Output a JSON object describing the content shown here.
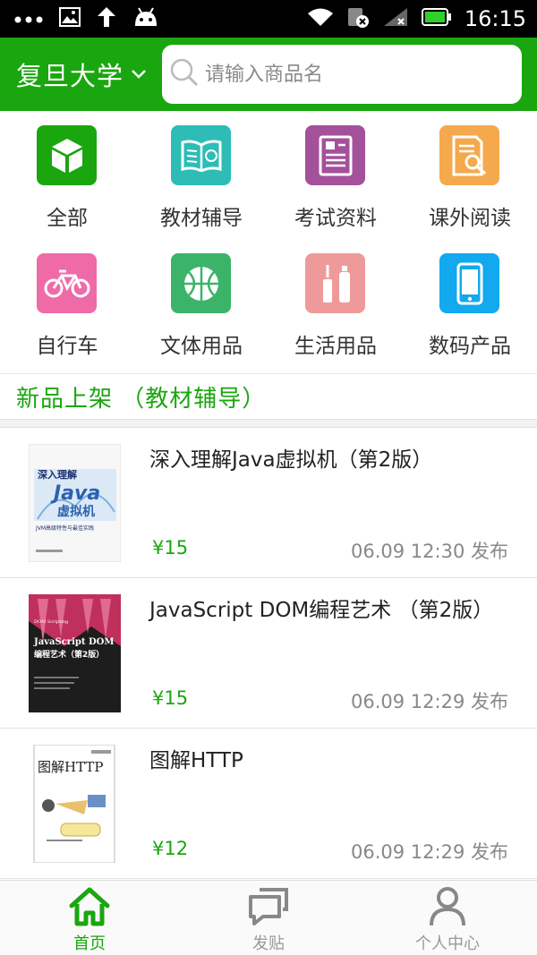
{
  "status_bar": {
    "time": "16:15",
    "left_icons": [
      "more-dots-icon",
      "image-icon",
      "upload-arrow-icon",
      "android-icon"
    ],
    "right_icons": [
      "wifi-icon",
      "no-sim-icon",
      "signal-icon",
      "battery-icon"
    ]
  },
  "header": {
    "campus": "复旦大学",
    "search_placeholder": "请输入商品名",
    "accent_color": "#1aa60f"
  },
  "categories": [
    {
      "label": "全部",
      "icon": "cube-icon",
      "color": "#1aa60f"
    },
    {
      "label": "教材辅导",
      "icon": "book-icon",
      "color": "#2dbcb6"
    },
    {
      "label": "考试资料",
      "icon": "exam-doc-icon",
      "color": "#a4519b"
    },
    {
      "label": "课外阅读",
      "icon": "reading-search-icon",
      "color": "#f5a94d"
    },
    {
      "label": "自行车",
      "icon": "bicycle-icon",
      "color": "#ef6ba8"
    },
    {
      "label": "文体用品",
      "icon": "basketball-icon",
      "color": "#3bb469"
    },
    {
      "label": "生活用品",
      "icon": "toiletries-icon",
      "color": "#ef9a9a"
    },
    {
      "label": "数码产品",
      "icon": "phone-icon",
      "color": "#12a9ee"
    }
  ],
  "section": {
    "title": "新品上架 （教材辅导）"
  },
  "products": [
    {
      "title": "深入理解Java虚拟机（第2版）",
      "price": "¥15",
      "time": "06.09 12:30 发布",
      "cover": "java-vm-book-cover"
    },
    {
      "title": "JavaScript DOM编程艺术 （第2版）",
      "price": "¥15",
      "time": "06.09 12:29 发布",
      "cover": "javascript-dom-book-cover"
    },
    {
      "title": "图解HTTP",
      "price": "¥12",
      "time": "06.09 12:29 发布",
      "cover": "http-book-cover"
    }
  ],
  "covers": {
    "java": {
      "line1": "深入理解",
      "line2": "Java",
      "line3": "虚拟机",
      "line4": "JVM高级特性与最佳实践"
    },
    "js": {
      "line1": "DOM Scripting",
      "line2": "JavaScript DOM",
      "line3": "编程艺术（第2版）"
    },
    "http": {
      "line1": "图解HTTP"
    }
  },
  "bottom_nav": [
    {
      "label": "首页",
      "icon": "home-icon",
      "active": true
    },
    {
      "label": "发贴",
      "icon": "post-message-icon",
      "active": false
    },
    {
      "label": "个人中心",
      "icon": "user-profile-icon",
      "active": false
    }
  ]
}
